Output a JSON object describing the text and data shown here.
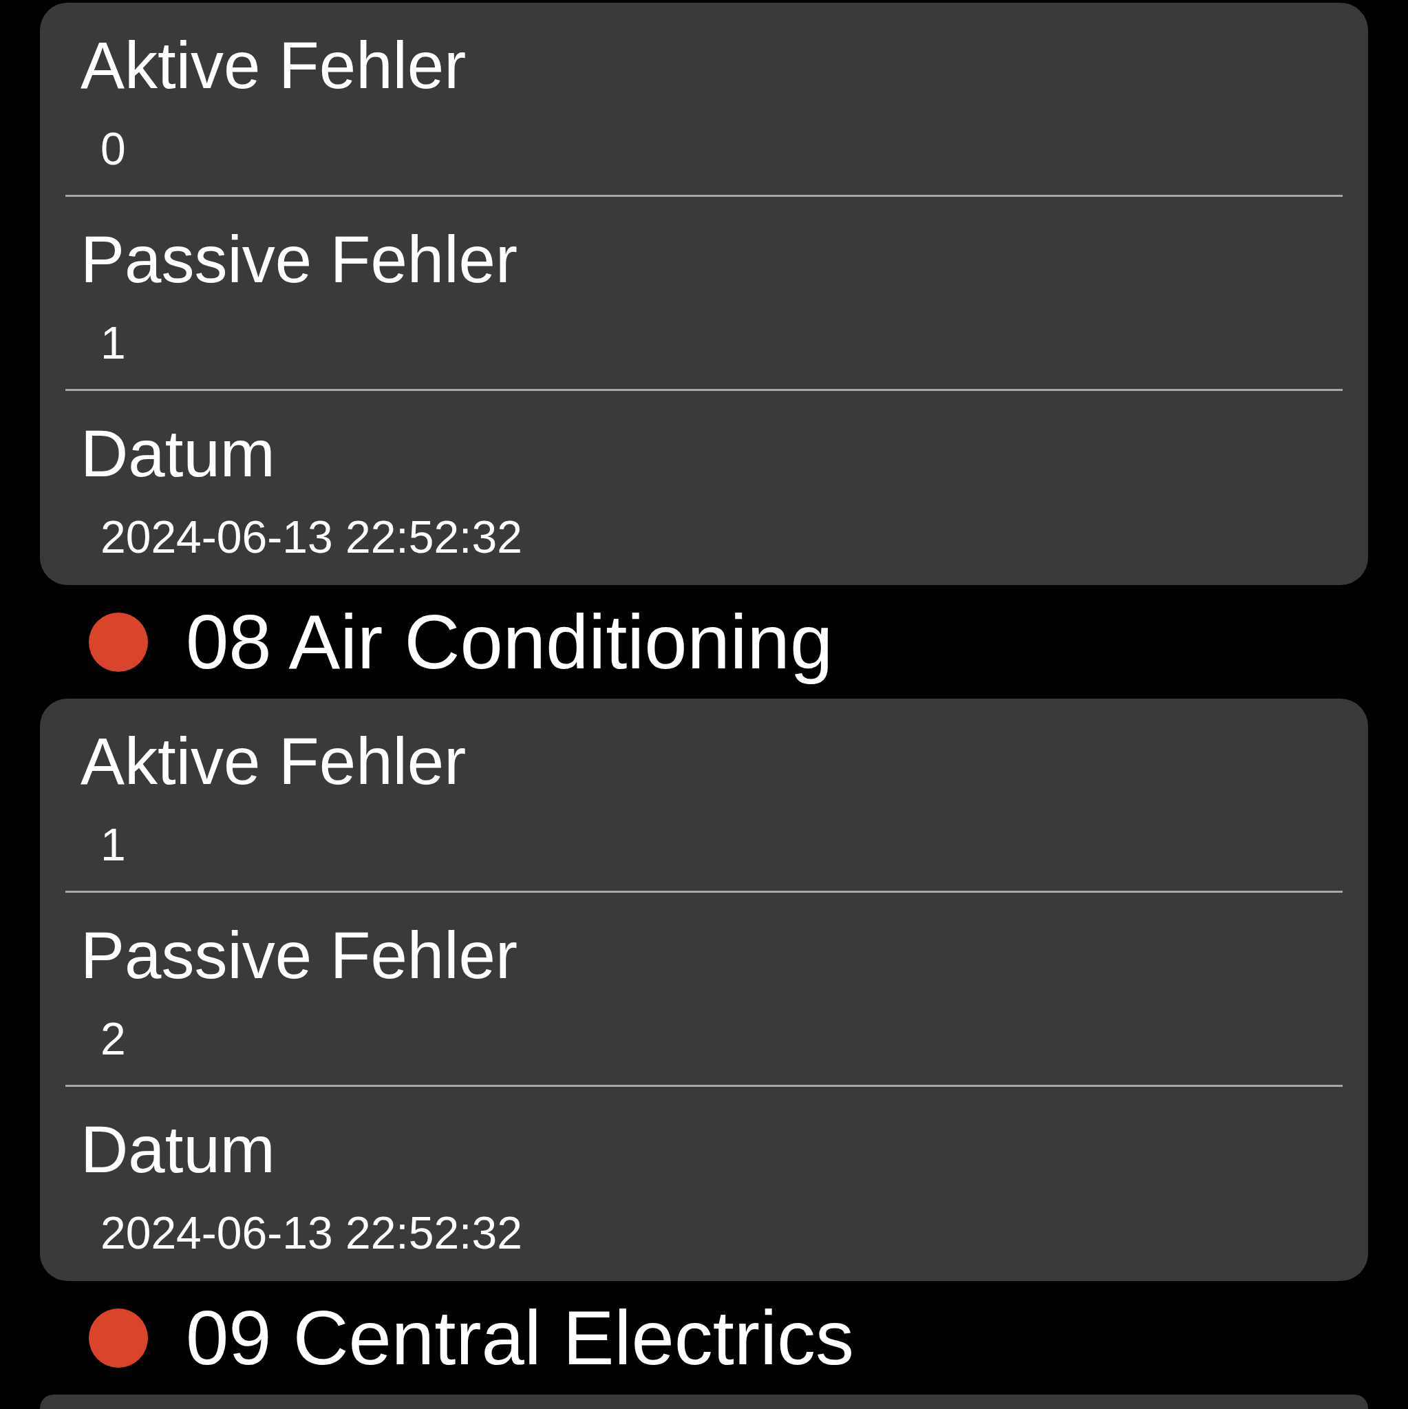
{
  "sections": [
    {
      "fields": [
        {
          "label": "Aktive Fehler",
          "value": "0"
        },
        {
          "label": "Passive Fehler",
          "value": "1"
        },
        {
          "label": "Datum",
          "value": "2024-06-13 22:52:32"
        }
      ]
    },
    {
      "title": "08 Air Conditioning",
      "color": "#d9452b",
      "fields": [
        {
          "label": "Aktive Fehler",
          "value": "1"
        },
        {
          "label": "Passive Fehler",
          "value": "2"
        },
        {
          "label": "Datum",
          "value": "2024-06-13 22:52:32"
        }
      ]
    },
    {
      "title": "09 Central Electrics",
      "color": "#d9452b"
    }
  ]
}
